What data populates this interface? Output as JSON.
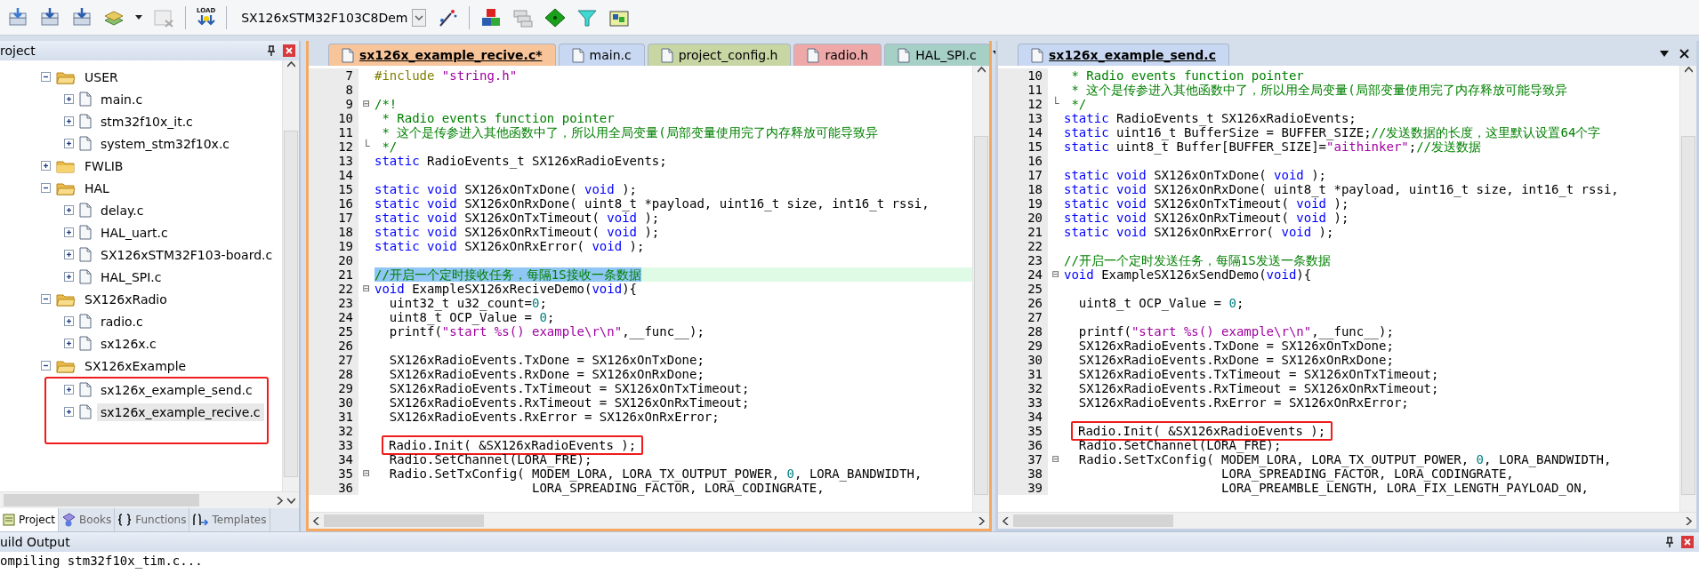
{
  "toolbar": {
    "load_label": "LOAD",
    "target": "SX126xSTM32F103C8Dem"
  },
  "project_panel": {
    "title": "roject",
    "tree": [
      {
        "label": "USER",
        "kind": "folder",
        "expanded": true,
        "selected": false,
        "boxed": false,
        "children": [
          {
            "label": "main.c",
            "kind": "file",
            "expanded": false,
            "selected": false,
            "boxed": false
          },
          {
            "label": "stm32f10x_it.c",
            "kind": "file",
            "expanded": false,
            "selected": false,
            "boxed": false
          },
          {
            "label": "system_stm32f10x.c",
            "kind": "file",
            "expanded": false,
            "selected": false,
            "boxed": false
          }
        ]
      },
      {
        "label": "FWLIB",
        "kind": "folder",
        "expanded": false,
        "selected": false,
        "boxed": false
      },
      {
        "label": "HAL",
        "kind": "folder",
        "expanded": true,
        "selected": false,
        "boxed": false,
        "children": [
          {
            "label": "delay.c",
            "kind": "file",
            "expanded": false,
            "selected": false,
            "boxed": false
          },
          {
            "label": "HAL_uart.c",
            "kind": "file",
            "expanded": false,
            "selected": false,
            "boxed": false
          },
          {
            "label": "SX126xSTM32F103-board.c",
            "kind": "file",
            "expanded": false,
            "selected": false,
            "boxed": false
          },
          {
            "label": "HAL_SPI.c",
            "kind": "file",
            "expanded": false,
            "selected": false,
            "boxed": false
          }
        ]
      },
      {
        "label": "SX126xRadio",
        "kind": "folder",
        "expanded": true,
        "selected": false,
        "boxed": false,
        "children": [
          {
            "label": "radio.c",
            "kind": "file",
            "expanded": false,
            "selected": false,
            "boxed": false
          },
          {
            "label": "sx126x.c",
            "kind": "file",
            "expanded": false,
            "selected": false,
            "boxed": false
          }
        ]
      },
      {
        "label": "SX126xExample",
        "kind": "folder",
        "expanded": true,
        "selected": false,
        "boxed": false,
        "children": [
          {
            "label": "sx126x_example_send.c",
            "kind": "file",
            "expanded": false,
            "selected": false,
            "boxed": true
          },
          {
            "label": "sx126x_example_recive.c",
            "kind": "file",
            "expanded": false,
            "selected": true,
            "boxed": true
          }
        ]
      }
    ],
    "tabs": [
      {
        "label": "Project",
        "selected": true
      },
      {
        "label": "Books",
        "selected": false
      },
      {
        "label": "Functions",
        "selected": false
      },
      {
        "label": "Templates",
        "selected": false
      }
    ]
  },
  "editors": [
    {
      "active": true,
      "tabs": [
        {
          "label": "sx126x_example_recive.c*",
          "selected": true,
          "color": "#f8c49a"
        },
        {
          "label": "main.c",
          "selected": false,
          "color": "#c9d8f2"
        },
        {
          "label": "project_config.h",
          "selected": false,
          "color": "#c8d6a4"
        },
        {
          "label": "radio.h",
          "selected": false,
          "color": "#eea8a8"
        },
        {
          "label": "HAL_SPI.c",
          "selected": false,
          "color": "#a6cfc6"
        }
      ],
      "lines": [
        {
          "num": "7",
          "kind": "code",
          "tokens": [
            {
              "kind": "pp",
              "text": "#include "
            },
            {
              "kind": "str",
              "text": "\"string.h\""
            }
          ]
        },
        {
          "num": "8",
          "kind": "code"
        },
        {
          "num": "9",
          "kind": "code",
          "gutter": "⊟",
          "tokens": [
            {
              "kind": "cm",
              "text": "/*!"
            }
          ]
        },
        {
          "num": "10",
          "kind": "code",
          "tokens": [
            {
              "kind": "cm",
              "text": " * Radio events function pointer"
            }
          ]
        },
        {
          "num": "11",
          "kind": "code",
          "tokens": [
            {
              "kind": "cm",
              "text": " * 这个是传参进入其他函数中了，所以用全局变量(局部变量使用完了内存释放可能导致异"
            }
          ]
        },
        {
          "num": "12",
          "kind": "code",
          "gutter": "└",
          "tokens": [
            {
              "kind": "cm",
              "text": " */"
            }
          ]
        },
        {
          "num": "13",
          "kind": "code",
          "tokens": [
            {
              "kind": "kw",
              "text": "static"
            },
            {
              "kind": "pl",
              "text": " RadioEvents_t SX126xRadioEvents;"
            }
          ]
        },
        {
          "num": "14",
          "kind": "code"
        },
        {
          "num": "15",
          "kind": "code",
          "tokens": [
            {
              "kind": "kw",
              "text": "static void"
            },
            {
              "kind": "pl",
              "text": " SX126xOnTxDone( "
            },
            {
              "kind": "kw",
              "text": "void"
            },
            {
              "kind": "pl",
              "text": " );"
            }
          ]
        },
        {
          "num": "16",
          "kind": "code",
          "tokens": [
            {
              "kind": "kw",
              "text": "static void"
            },
            {
              "kind": "pl",
              "text": " SX126xOnRxDone( uint8_t *payload, uint16_t size, int16_t rssi,"
            }
          ]
        },
        {
          "num": "17",
          "kind": "code",
          "tokens": [
            {
              "kind": "kw",
              "text": "static void"
            },
            {
              "kind": "pl",
              "text": " SX126xOnTxTimeout( "
            },
            {
              "kind": "kw",
              "text": "void"
            },
            {
              "kind": "pl",
              "text": " );"
            }
          ]
        },
        {
          "num": "18",
          "kind": "code",
          "tokens": [
            {
              "kind": "kw",
              "text": "static void"
            },
            {
              "kind": "pl",
              "text": " SX126xOnRxTimeout( "
            },
            {
              "kind": "kw",
              "text": "void"
            },
            {
              "kind": "pl",
              "text": " );"
            }
          ]
        },
        {
          "num": "19",
          "kind": "code",
          "tokens": [
            {
              "kind": "kw",
              "text": "static void"
            },
            {
              "kind": "pl",
              "text": " SX126xOnRxError( "
            },
            {
              "kind": "kw",
              "text": "void"
            },
            {
              "kind": "pl",
              "text": " );"
            }
          ]
        },
        {
          "num": "20",
          "kind": "code"
        },
        {
          "num": "21",
          "kind": "current",
          "tokens": [
            {
              "kind": "cm",
              "text": "//开启一个定时接收任务，每隔1S接收一条数据"
            }
          ]
        },
        {
          "num": "22",
          "kind": "code",
          "gutter": "⊟",
          "tokens": [
            {
              "kind": "kw",
              "text": "void"
            },
            {
              "kind": "pl",
              "text": " ExampleSX126xReciveDemo("
            },
            {
              "kind": "kw",
              "text": "void"
            },
            {
              "kind": "pl",
              "text": "){"
            }
          ]
        },
        {
          "num": "23",
          "kind": "code",
          "tokens": [
            {
              "kind": "pl",
              "text": "  uint32_t u32_count="
            },
            {
              "kind": "num",
              "text": "0"
            },
            {
              "kind": "pl",
              "text": ";"
            }
          ]
        },
        {
          "num": "24",
          "kind": "code",
          "tokens": [
            {
              "kind": "pl",
              "text": "  uint8_t OCP_Value = "
            },
            {
              "kind": "num",
              "text": "0"
            },
            {
              "kind": "pl",
              "text": ";"
            }
          ]
        },
        {
          "num": "25",
          "kind": "code",
          "tokens": [
            {
              "kind": "pl",
              "text": "  printf("
            },
            {
              "kind": "str",
              "text": "\"start %s() example\\r\\n\""
            },
            {
              "kind": "pl",
              "text": ",__func__);"
            }
          ]
        },
        {
          "num": "26",
          "kind": "code"
        },
        {
          "num": "27",
          "kind": "code",
          "tokens": [
            {
              "kind": "pl",
              "text": "  SX126xRadioEvents.TxDone = SX126xOnTxDone;"
            }
          ]
        },
        {
          "num": "28",
          "kind": "code",
          "tokens": [
            {
              "kind": "pl",
              "text": "  SX126xRadioEvents.RxDone = SX126xOnRxDone;"
            }
          ]
        },
        {
          "num": "29",
          "kind": "code",
          "tokens": [
            {
              "kind": "pl",
              "text": "  SX126xRadioEvents.TxTimeout = SX126xOnTxTimeout;"
            }
          ]
        },
        {
          "num": "30",
          "kind": "code",
          "tokens": [
            {
              "kind": "pl",
              "text": "  SX126xRadioEvents.RxTimeout = SX126xOnRxTimeout;"
            }
          ]
        },
        {
          "num": "31",
          "kind": "code",
          "tokens": [
            {
              "kind": "pl",
              "text": "  SX126xRadioEvents.RxError = SX126xOnRxError;"
            }
          ]
        },
        {
          "num": "32",
          "kind": "code"
        },
        {
          "num": "33",
          "kind": "boxed",
          "tokens": [
            {
              "kind": "pl",
              "text": "Radio.Init( &SX126xRadioEvents );"
            }
          ]
        },
        {
          "num": "34",
          "kind": "code",
          "tokens": [
            {
              "kind": "pl",
              "text": "  Radio.SetChannel(LORA_FRE);"
            }
          ]
        },
        {
          "num": "35",
          "kind": "code",
          "gutter": "⊟",
          "tokens": [
            {
              "kind": "pl",
              "text": "  Radio.SetTxConfig( MODEM_LORA, LORA_TX_OUTPUT_POWER, "
            },
            {
              "kind": "num",
              "text": "0"
            },
            {
              "kind": "pl",
              "text": ", LORA_BANDWIDTH,"
            }
          ]
        },
        {
          "num": "36",
          "kind": "code",
          "tokens": [
            {
              "kind": "pl",
              "text": "                     LORA_SPREADING_FACTOR, LORA_CODINGRATE,"
            }
          ]
        }
      ]
    },
    {
      "active": false,
      "tabs": [
        {
          "label": "sx126x_example_send.c",
          "selected": true,
          "color": "#c9d8f2"
        }
      ],
      "lines": [
        {
          "num": "10",
          "kind": "code",
          "tokens": [
            {
              "kind": "cm",
              "text": " * Radio events function pointer"
            }
          ]
        },
        {
          "num": "11",
          "kind": "code",
          "tokens": [
            {
              "kind": "cm",
              "text": " * 这个是传参进入其他函数中了，所以用全局变量(局部变量使用完了内存释放可能导致异"
            }
          ]
        },
        {
          "num": "12",
          "kind": "code",
          "gutter": "└",
          "tokens": [
            {
              "kind": "cm",
              "text": " */"
            }
          ]
        },
        {
          "num": "13",
          "kind": "code",
          "tokens": [
            {
              "kind": "kw",
              "text": "static"
            },
            {
              "kind": "pl",
              "text": " RadioEvents_t SX126xRadioEvents;"
            }
          ]
        },
        {
          "num": "14",
          "kind": "code",
          "tokens": [
            {
              "kind": "kw",
              "text": "static"
            },
            {
              "kind": "pl",
              "text": " uint16_t BufferSize = BUFFER_SIZE;"
            },
            {
              "kind": "cm",
              "text": "//发送数据的长度，这里默认设置64个字"
            }
          ]
        },
        {
          "num": "15",
          "kind": "code",
          "tokens": [
            {
              "kind": "kw",
              "text": "static"
            },
            {
              "kind": "pl",
              "text": " uint8_t Buffer[BUFFER_SIZE]="
            },
            {
              "kind": "str",
              "text": "\"aithinker\""
            },
            {
              "kind": "pl",
              "text": ";"
            },
            {
              "kind": "cm",
              "text": "//发送数据"
            }
          ]
        },
        {
          "num": "16",
          "kind": "code"
        },
        {
          "num": "17",
          "kind": "code",
          "tokens": [
            {
              "kind": "kw",
              "text": "static void"
            },
            {
              "kind": "pl",
              "text": " SX126xOnTxDone( "
            },
            {
              "kind": "kw",
              "text": "void"
            },
            {
              "kind": "pl",
              "text": " );"
            }
          ]
        },
        {
          "num": "18",
          "kind": "code",
          "tokens": [
            {
              "kind": "kw",
              "text": "static void"
            },
            {
              "kind": "pl",
              "text": " SX126xOnRxDone( uint8_t *payload, uint16_t size, int16_t rssi,"
            }
          ]
        },
        {
          "num": "19",
          "kind": "code",
          "tokens": [
            {
              "kind": "kw",
              "text": "static void"
            },
            {
              "kind": "pl",
              "text": " SX126xOnTxTimeout( "
            },
            {
              "kind": "kw",
              "text": "void"
            },
            {
              "kind": "pl",
              "text": " );"
            }
          ]
        },
        {
          "num": "20",
          "kind": "code",
          "tokens": [
            {
              "kind": "kw",
              "text": "static void"
            },
            {
              "kind": "pl",
              "text": " SX126xOnRxTimeout( "
            },
            {
              "kind": "kw",
              "text": "void"
            },
            {
              "kind": "pl",
              "text": " );"
            }
          ]
        },
        {
          "num": "21",
          "kind": "code",
          "tokens": [
            {
              "kind": "kw",
              "text": "static void"
            },
            {
              "kind": "pl",
              "text": " SX126xOnRxError( "
            },
            {
              "kind": "kw",
              "text": "void"
            },
            {
              "kind": "pl",
              "text": " );"
            }
          ]
        },
        {
          "num": "22",
          "kind": "code"
        },
        {
          "num": "23",
          "kind": "code",
          "tokens": [
            {
              "kind": "cm",
              "text": "//开启一个定时发送任务，每隔1S发送一条数据"
            }
          ]
        },
        {
          "num": "24",
          "kind": "code",
          "gutter": "⊟",
          "tokens": [
            {
              "kind": "kw",
              "text": "void"
            },
            {
              "kind": "pl",
              "text": " ExampleSX126xSendDemo("
            },
            {
              "kind": "kw",
              "text": "void"
            },
            {
              "kind": "pl",
              "text": "){"
            }
          ]
        },
        {
          "num": "25",
          "kind": "code"
        },
        {
          "num": "26",
          "kind": "code",
          "tokens": [
            {
              "kind": "pl",
              "text": "  uint8_t OCP_Value = "
            },
            {
              "kind": "num",
              "text": "0"
            },
            {
              "kind": "pl",
              "text": ";"
            }
          ]
        },
        {
          "num": "27",
          "kind": "code"
        },
        {
          "num": "28",
          "kind": "code",
          "tokens": [
            {
              "kind": "pl",
              "text": "  printf("
            },
            {
              "kind": "str",
              "text": "\"start %s() example\\r\\n\""
            },
            {
              "kind": "pl",
              "text": ",__func__);"
            }
          ]
        },
        {
          "num": "29",
          "kind": "code",
          "tokens": [
            {
              "kind": "pl",
              "text": "  SX126xRadioEvents.TxDone = SX126xOnTxDone;"
            }
          ]
        },
        {
          "num": "30",
          "kind": "code",
          "tokens": [
            {
              "kind": "pl",
              "text": "  SX126xRadioEvents.RxDone = SX126xOnRxDone;"
            }
          ]
        },
        {
          "num": "31",
          "kind": "code",
          "tokens": [
            {
              "kind": "pl",
              "text": "  SX126xRadioEvents.TxTimeout = SX126xOnTxTimeout;"
            }
          ]
        },
        {
          "num": "32",
          "kind": "code",
          "tokens": [
            {
              "kind": "pl",
              "text": "  SX126xRadioEvents.RxTimeout = SX126xOnRxTimeout;"
            }
          ]
        },
        {
          "num": "33",
          "kind": "code",
          "tokens": [
            {
              "kind": "pl",
              "text": "  SX126xRadioEvents.RxError = SX126xOnRxError;"
            }
          ]
        },
        {
          "num": "34",
          "kind": "code"
        },
        {
          "num": "35",
          "kind": "boxed",
          "tokens": [
            {
              "kind": "pl",
              "text": "Radio.Init( &SX126xRadioEvents );"
            }
          ]
        },
        {
          "num": "36",
          "kind": "code",
          "tokens": [
            {
              "kind": "pl",
              "text": "  Radio.SetChannel(LORA_FRE);"
            }
          ]
        },
        {
          "num": "37",
          "kind": "code",
          "gutter": "⊟",
          "tokens": [
            {
              "kind": "pl",
              "text": "  Radio.SetTxConfig( MODEM_LORA, LORA_TX_OUTPUT_POWER, "
            },
            {
              "kind": "num",
              "text": "0"
            },
            {
              "kind": "pl",
              "text": ", LORA_BANDWIDTH,"
            }
          ]
        },
        {
          "num": "38",
          "kind": "code",
          "tokens": [
            {
              "kind": "pl",
              "text": "                     LORA_SPREADING_FACTOR, LORA_CODINGRATE,"
            }
          ]
        },
        {
          "num": "39",
          "kind": "code",
          "tokens": [
            {
              "kind": "pl",
              "text": "                     LORA_PREAMBLE_LENGTH, LORA_FIX_LENGTH_PAYLOAD_ON,"
            }
          ]
        }
      ]
    }
  ],
  "build_output": {
    "title": "uild Output",
    "lines": [
      "ompiling stm32f10x_tim.c..."
    ]
  }
}
